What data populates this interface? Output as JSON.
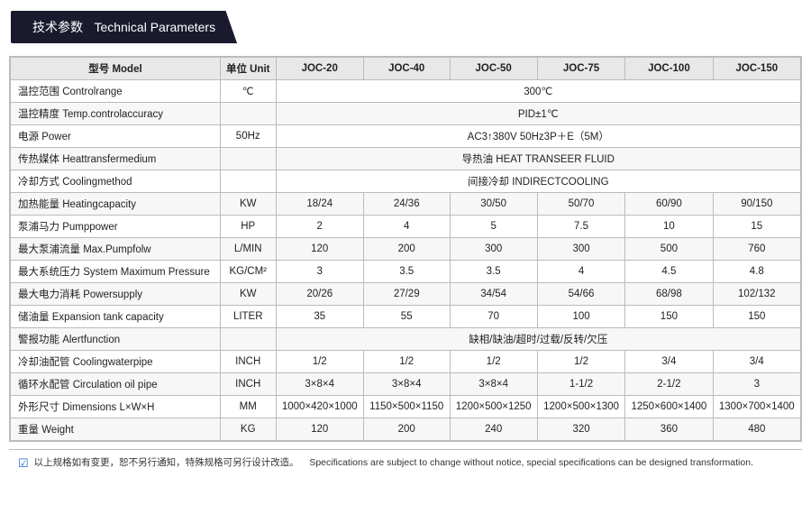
{
  "header": {
    "cn_title": "技术参数",
    "en_title": "Technical Parameters"
  },
  "table": {
    "columns": [
      "型号 Model",
      "单位 Unit",
      "JOC-20",
      "JOC-40",
      "JOC-50",
      "JOC-75",
      "JOC-100",
      "JOC-150"
    ],
    "rows": [
      {
        "label": "温控范围 Controlrange",
        "unit": "℃",
        "values": [
          "300℃",
          "",
          "",
          "",
          "",
          ""
        ]
      },
      {
        "label": "温控精度 Temp.controlaccuracy",
        "unit": "",
        "values": [
          "PID±1℃",
          "",
          "",
          "",
          "",
          ""
        ]
      },
      {
        "label": "电源 Power",
        "unit": "50Hz",
        "values": [
          "AC3↑380V 50Hz3P＋E（5M）",
          "",
          "",
          "",
          "",
          ""
        ]
      },
      {
        "label": "传热媒体 Heattransfermedium",
        "unit": "",
        "values": [
          "导热油 HEAT TRANSEER FLUID",
          "",
          "",
          "",
          "",
          ""
        ]
      },
      {
        "label": "冷却方式 Coolingmethod",
        "unit": "",
        "values": [
          "间接冷却 INDIRECTCOOLING",
          "",
          "",
          "",
          "",
          ""
        ]
      },
      {
        "label": "加热能量 Heatingcapacity",
        "unit": "KW",
        "values": [
          "18/24",
          "24/36",
          "30/50",
          "50/70",
          "60/90",
          "90/150"
        ]
      },
      {
        "label": "泵浦马力 Pumppower",
        "unit": "HP",
        "values": [
          "2",
          "4",
          "5",
          "7.5",
          "10",
          "15"
        ]
      },
      {
        "label": "最大泵浦流量 Max.Pumpfolw",
        "unit": "L/MIN",
        "values": [
          "120",
          "200",
          "300",
          "300",
          "500",
          "760"
        ]
      },
      {
        "label": "最大系统压力 System Maximum Pressure",
        "unit": "KG/CM²",
        "values": [
          "3",
          "3.5",
          "3.5",
          "4",
          "4.5",
          "4.8"
        ]
      },
      {
        "label": "最大电力消耗 Powersupply",
        "unit": "KW",
        "values": [
          "20/26",
          "27/29",
          "34/54",
          "54/66",
          "68/98",
          "102/132"
        ]
      },
      {
        "label": "储油量 Expansion tank capacity",
        "unit": "LITER",
        "values": [
          "35",
          "55",
          "70",
          "100",
          "150",
          "150"
        ]
      },
      {
        "label": "警报功能 Alertfunction",
        "unit": "",
        "values": [
          "缺相/缺油/超时/过载/反转/欠压",
          "",
          "",
          "",
          "",
          ""
        ]
      },
      {
        "label": "冷却油配管 Coolingwaterpipe",
        "unit": "INCH",
        "values": [
          "1/2",
          "1/2",
          "1/2",
          "1/2",
          "3/4",
          "3/4"
        ]
      },
      {
        "label": "循环水配管 Circulation oil pipe",
        "unit": "INCH",
        "values": [
          "3×8×4",
          "3×8×4",
          "3×8×4",
          "1-1/2",
          "2-1/2",
          "3"
        ]
      },
      {
        "label": "外形尺寸 Dimensions L×W×H",
        "unit": "MM",
        "values": [
          "1000×420×1000",
          "1150×500×1150",
          "1200×500×1250",
          "1200×500×1300",
          "1250×600×1400",
          "1300×700×1400"
        ]
      },
      {
        "label": "重量 Weight",
        "unit": "KG",
        "values": [
          "120",
          "200",
          "240",
          "320",
          "360",
          "480"
        ]
      }
    ]
  },
  "footer": {
    "icon": "✔",
    "cn_text": "以上规格如有变更，恕不另行通知，特殊规格可另行设计改造。",
    "en_text": "Specifications are subject to change without notice, special specifications can be designed transformation."
  },
  "spans_full": [
    0,
    1,
    2,
    3,
    4,
    11
  ],
  "row_span_map": {
    "0": {
      "span": 6,
      "colspan_start": 2
    },
    "1": {
      "span": 6,
      "colspan_start": 2
    },
    "2": {
      "span": 6,
      "colspan_start": 2
    },
    "3": {
      "span": 6,
      "colspan_start": 2
    },
    "4": {
      "span": 6,
      "colspan_start": 2
    },
    "11": {
      "span": 6,
      "colspan_start": 2
    }
  }
}
